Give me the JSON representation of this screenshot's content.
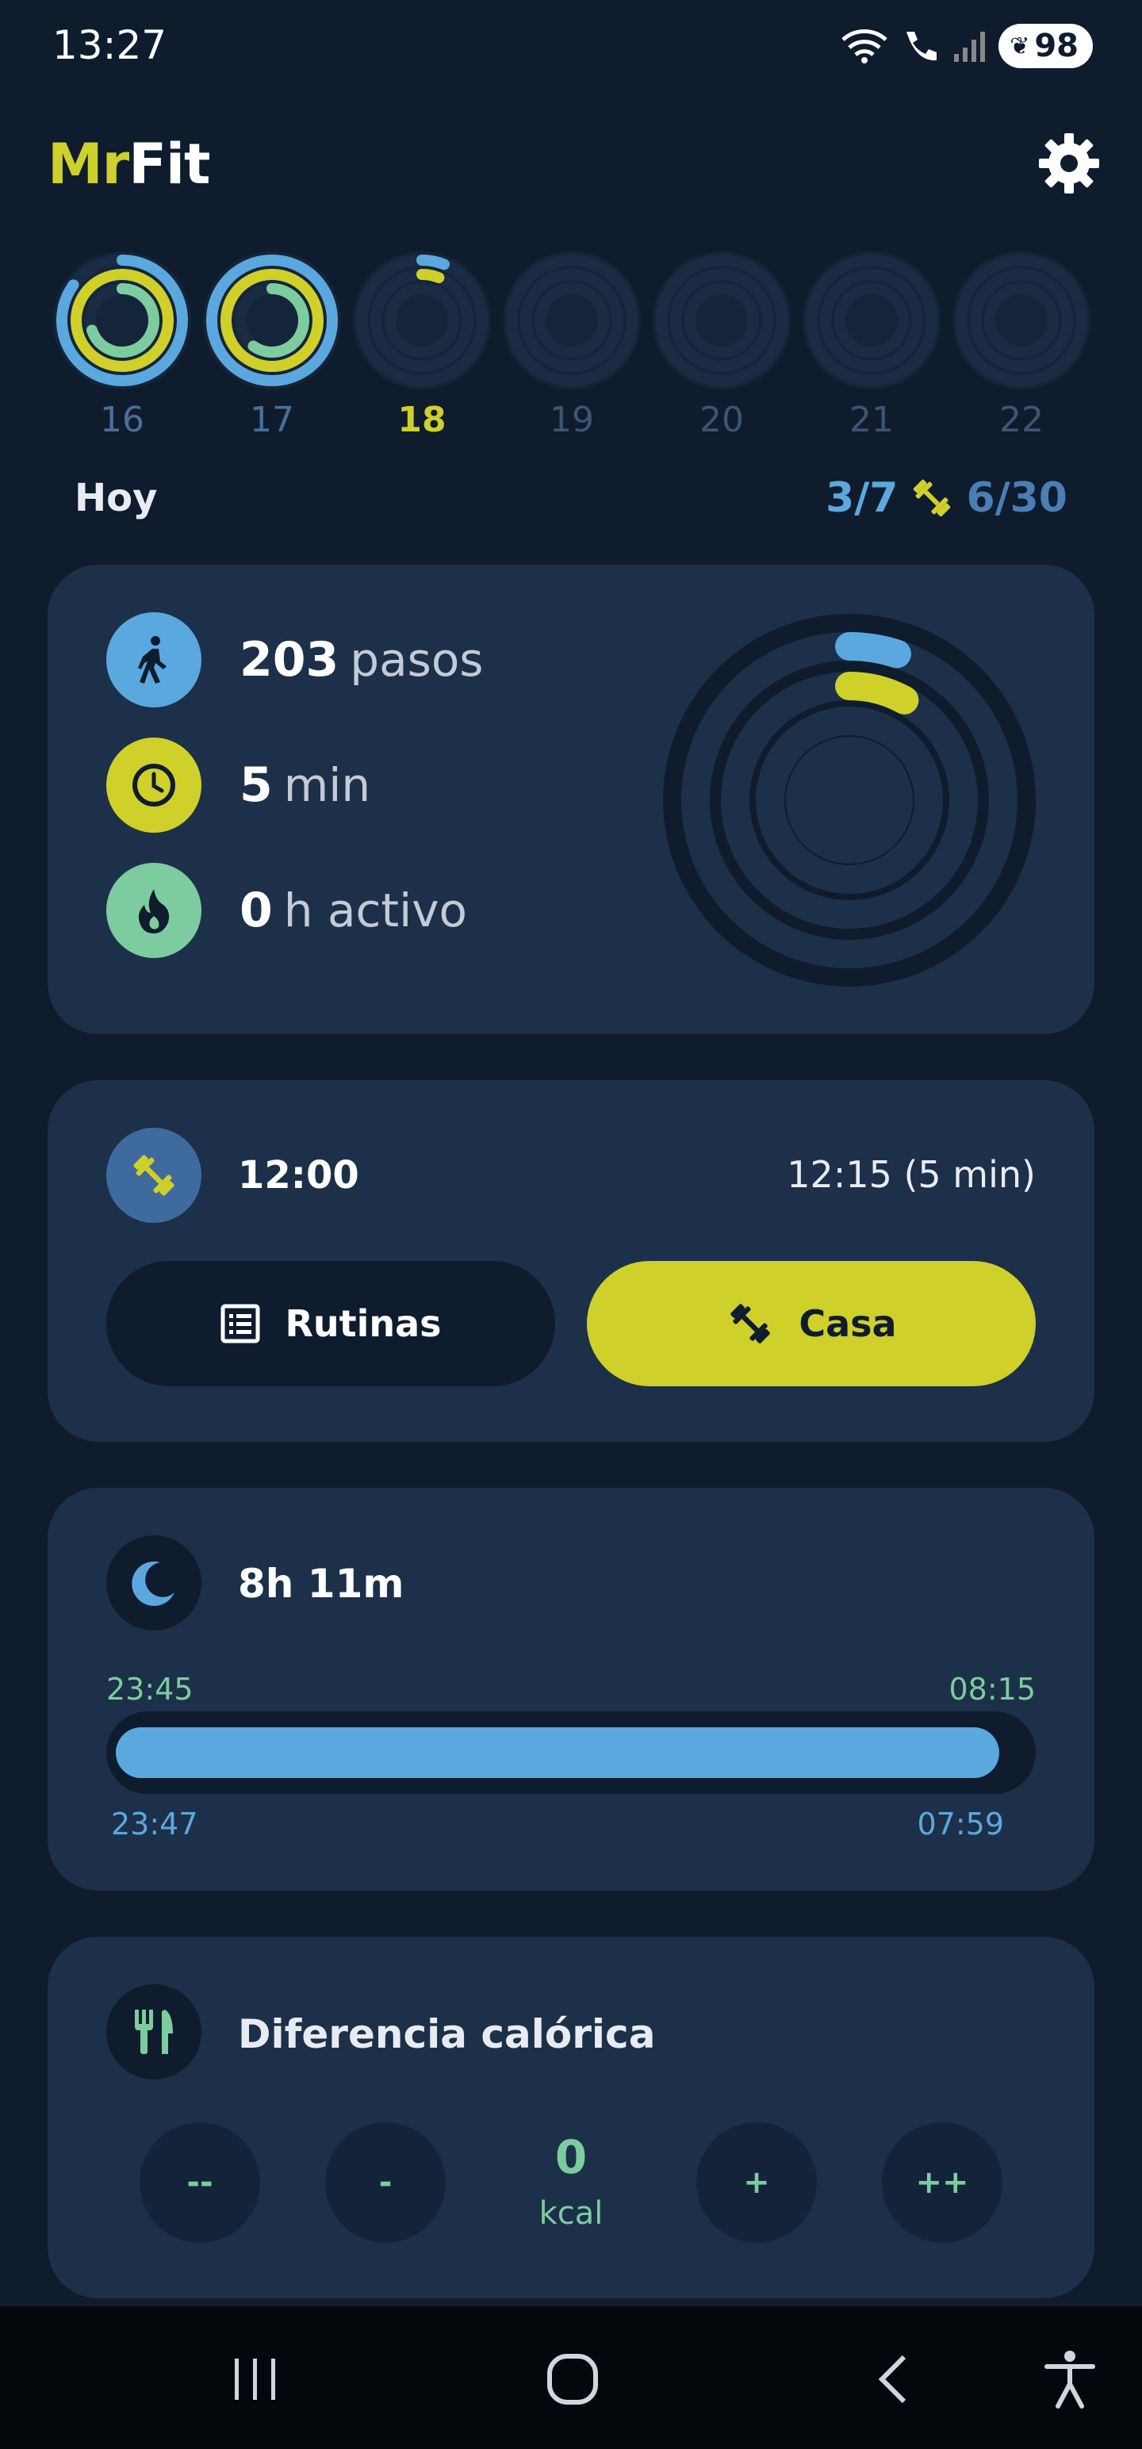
{
  "status_bar": {
    "time": "13:27",
    "battery": "98"
  },
  "header": {
    "logo_part1": "Mr",
    "logo_part2": "Fit"
  },
  "week": {
    "days": [
      {
        "label": "16",
        "steps_progress": 0.85,
        "minutes_progress": 1.0,
        "active_progress": 0.7
      },
      {
        "label": "17",
        "steps_progress": 1.0,
        "minutes_progress": 1.0,
        "active_progress": 0.6
      },
      {
        "label": "18",
        "steps_progress": 0.06,
        "minutes_progress": 0.06,
        "active_progress": 0.0
      },
      {
        "label": "19",
        "steps_progress": 0,
        "minutes_progress": 0,
        "active_progress": 0
      },
      {
        "label": "20",
        "steps_progress": 0,
        "minutes_progress": 0,
        "active_progress": 0
      },
      {
        "label": "21",
        "steps_progress": 0,
        "minutes_progress": 0,
        "active_progress": 0
      },
      {
        "label": "22",
        "steps_progress": 0,
        "minutes_progress": 0,
        "active_progress": 0
      }
    ]
  },
  "today": {
    "label": "Hoy",
    "week_goal": "3/7",
    "workout_goal": "6/30"
  },
  "activity": {
    "steps_value": "203",
    "steps_unit": "pasos",
    "minutes_value": "5",
    "minutes_unit": "min",
    "active_value": "0",
    "active_unit": "h activo",
    "steps_progress": 0.05,
    "minutes_progress": 0.08,
    "active_progress": 0.0
  },
  "workout": {
    "start": "12:00",
    "end": "12:15 (5 min)",
    "routines_label": "Rutinas",
    "home_label": "Casa"
  },
  "sleep": {
    "duration": "8h 11m",
    "target_start": "23:45",
    "target_end": "08:15",
    "actual_start": "23:47",
    "actual_end": "07:59",
    "progress": 0.97
  },
  "calories": {
    "title": "Diferencia calórica",
    "btn_minus2": "--",
    "btn_minus1": "-",
    "value": "0",
    "unit": "kcal",
    "btn_plus1": "+",
    "btn_plus2": "++"
  },
  "colors": {
    "background": "#0f1c2e",
    "card": "#1d3049",
    "accent_yellow": "#cfd02a",
    "accent_blue": "#5ba8df",
    "accent_green": "#7ccc9f"
  }
}
